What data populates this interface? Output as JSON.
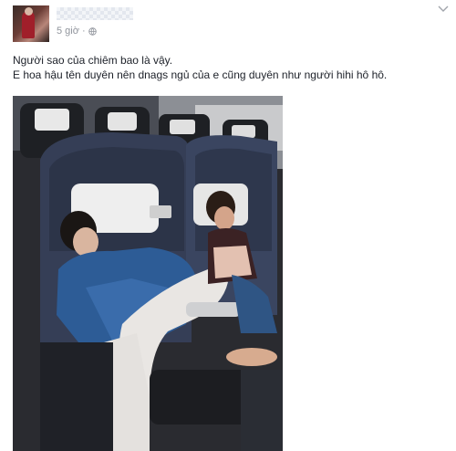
{
  "post": {
    "timestamp": "5 giờ",
    "separator": "·",
    "privacy_icon": "globe-icon",
    "lines": [
      "Người sao của chiêm bao là vậy.",
      "E hoa hậu tên duyên nên dnags ngủ của e cũng duyên như người hihi hô hô."
    ]
  },
  "colors": {
    "text": "#1d2129",
    "meta": "#90949c",
    "seat_blue": "#3b4a70",
    "shirt_blue": "#2d5c96"
  }
}
